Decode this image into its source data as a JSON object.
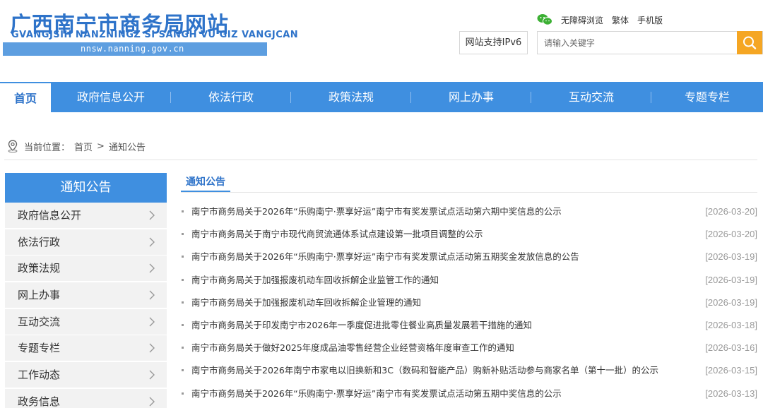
{
  "header": {
    "logo_title": "广西南宁市商务局网站",
    "logo_pinyin": "GVANGJSIH NANZNINGZ SI  SANGH VU GIZ VANGJCAN",
    "logo_url": "nnsw.nanning.gov.cn",
    "top_links": [
      "无障碍浏览",
      "繁体",
      "手机版"
    ],
    "ipv6_label": "网站支持IPv6",
    "search_placeholder": "请输入关键字",
    "colors": {
      "brand": "#2e73c9",
      "nav": "#3f8fe0",
      "search_button": "#f5a623",
      "wechat": "#3cb034"
    }
  },
  "nav": {
    "items": [
      "首页",
      "政府信息公开",
      "依法行政",
      "政策法规",
      "网上办事",
      "互动交流",
      "专题专栏"
    ],
    "active_index": 0
  },
  "breadcrumb": {
    "prefix": "当前位置：",
    "home": "首页",
    "separator": ">",
    "current": "通知公告"
  },
  "sidebar": {
    "title": "通知公告",
    "items": [
      "政府信息公开",
      "依法行政",
      "政策法规",
      "网上办事",
      "互动交流",
      "专题专栏",
      "工作动态",
      "政务信息"
    ]
  },
  "main": {
    "tab_label": "通知公告",
    "news": [
      {
        "title": "南宁市商务局关于2026年“乐购南宁·票享好运”南宁市有奖发票试点活动第六期中奖信息的公示",
        "date": "[2026-03-20]"
      },
      {
        "title": "南宁市商务局关于南宁市现代商贸流通体系试点建设第一批项目调整的公示",
        "date": "[2026-03-20]"
      },
      {
        "title": "南宁市商务局关于2026年“乐购南宁·票享好运”南宁市有奖发票试点活动第五期奖金发放信息的公告",
        "date": "[2026-03-19]"
      },
      {
        "title": "南宁市商务局关于加强报废机动车回收拆解企业监管工作的通知",
        "date": "[2026-03-19]"
      },
      {
        "title": "南宁市商务局关于加强报废机动车回收拆解企业管理的通知",
        "date": "[2026-03-19]"
      },
      {
        "title": "南宁市商务局关于印发南宁市2026年一季度促进批零住餐业高质量发展若干措施的通知",
        "date": "[2026-03-18]"
      },
      {
        "title": "南宁市商务局关于做好2025年度成品油零售经营企业经营资格年度审查工作的通知",
        "date": "[2026-03-16]"
      },
      {
        "title": "南宁市商务局关于2026年南宁市家电以旧换新和3C（数码和智能产品）购新补贴活动参与商家名单（第十一批）的公示",
        "date": "[2026-03-15]"
      },
      {
        "title": "南宁市商务局关于2026年“乐购南宁·票享好运”南宁市有奖发票试点活动第五期中奖信息的公示",
        "date": "[2026-03-13]"
      }
    ]
  }
}
